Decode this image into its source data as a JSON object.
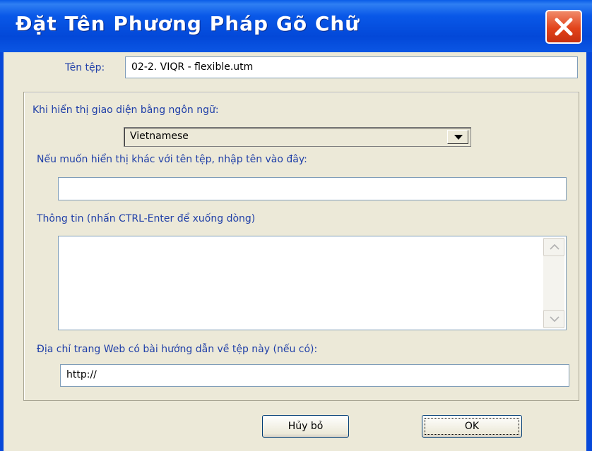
{
  "window": {
    "title": "Đặt Tên Phương Pháp Gõ Chữ"
  },
  "file": {
    "label": "Tên tệp:",
    "value": "02-2. VIQR - flexible.utm"
  },
  "language": {
    "label": "Khi hiển thị giao diện bằng ngôn ngữ:",
    "selected": "Vietnamese"
  },
  "display_name": {
    "label": "Nếu muốn hiển thị khác với tên tệp, nhập tên vào đây:",
    "value": ""
  },
  "info": {
    "label": "Thông tin (nhấn CTRL-Enter để xuống dòng)",
    "value": ""
  },
  "web": {
    "label": "Địa chỉ trang Web có bài hướng dẫn về tệp này (nếu có):",
    "value": "http://"
  },
  "buttons": {
    "cancel": "Hủy bỏ",
    "ok": "OK"
  },
  "icons": {
    "close": "close-icon",
    "dropdown": "chevron-down-icon",
    "scroll_up": "scroll-up-icon",
    "scroll_down": "scroll-down-icon"
  },
  "colors": {
    "titlebar": "#0348d8",
    "label_text": "#1f3fa8",
    "dialog_bg": "#ece9d8",
    "close_button": "#e2431a"
  }
}
